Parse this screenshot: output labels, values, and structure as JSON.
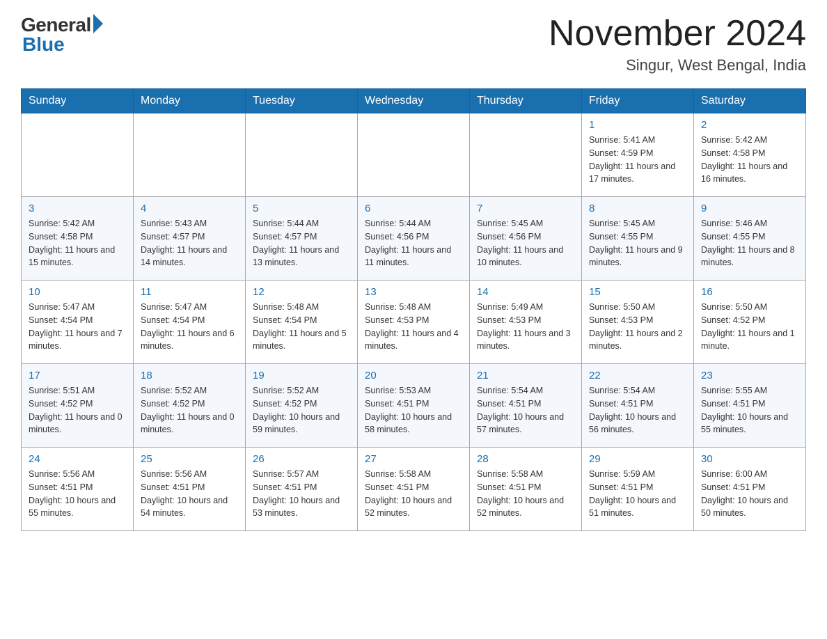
{
  "logo": {
    "general": "General",
    "blue": "Blue"
  },
  "title": {
    "month_year": "November 2024",
    "location": "Singur, West Bengal, India"
  },
  "headers": [
    "Sunday",
    "Monday",
    "Tuesday",
    "Wednesday",
    "Thursday",
    "Friday",
    "Saturday"
  ],
  "weeks": [
    [
      {
        "day": "",
        "info": ""
      },
      {
        "day": "",
        "info": ""
      },
      {
        "day": "",
        "info": ""
      },
      {
        "day": "",
        "info": ""
      },
      {
        "day": "",
        "info": ""
      },
      {
        "day": "1",
        "info": "Sunrise: 5:41 AM\nSunset: 4:59 PM\nDaylight: 11 hours and 17 minutes."
      },
      {
        "day": "2",
        "info": "Sunrise: 5:42 AM\nSunset: 4:58 PM\nDaylight: 11 hours and 16 minutes."
      }
    ],
    [
      {
        "day": "3",
        "info": "Sunrise: 5:42 AM\nSunset: 4:58 PM\nDaylight: 11 hours and 15 minutes."
      },
      {
        "day": "4",
        "info": "Sunrise: 5:43 AM\nSunset: 4:57 PM\nDaylight: 11 hours and 14 minutes."
      },
      {
        "day": "5",
        "info": "Sunrise: 5:44 AM\nSunset: 4:57 PM\nDaylight: 11 hours and 13 minutes."
      },
      {
        "day": "6",
        "info": "Sunrise: 5:44 AM\nSunset: 4:56 PM\nDaylight: 11 hours and 11 minutes."
      },
      {
        "day": "7",
        "info": "Sunrise: 5:45 AM\nSunset: 4:56 PM\nDaylight: 11 hours and 10 minutes."
      },
      {
        "day": "8",
        "info": "Sunrise: 5:45 AM\nSunset: 4:55 PM\nDaylight: 11 hours and 9 minutes."
      },
      {
        "day": "9",
        "info": "Sunrise: 5:46 AM\nSunset: 4:55 PM\nDaylight: 11 hours and 8 minutes."
      }
    ],
    [
      {
        "day": "10",
        "info": "Sunrise: 5:47 AM\nSunset: 4:54 PM\nDaylight: 11 hours and 7 minutes."
      },
      {
        "day": "11",
        "info": "Sunrise: 5:47 AM\nSunset: 4:54 PM\nDaylight: 11 hours and 6 minutes."
      },
      {
        "day": "12",
        "info": "Sunrise: 5:48 AM\nSunset: 4:54 PM\nDaylight: 11 hours and 5 minutes."
      },
      {
        "day": "13",
        "info": "Sunrise: 5:48 AM\nSunset: 4:53 PM\nDaylight: 11 hours and 4 minutes."
      },
      {
        "day": "14",
        "info": "Sunrise: 5:49 AM\nSunset: 4:53 PM\nDaylight: 11 hours and 3 minutes."
      },
      {
        "day": "15",
        "info": "Sunrise: 5:50 AM\nSunset: 4:53 PM\nDaylight: 11 hours and 2 minutes."
      },
      {
        "day": "16",
        "info": "Sunrise: 5:50 AM\nSunset: 4:52 PM\nDaylight: 11 hours and 1 minute."
      }
    ],
    [
      {
        "day": "17",
        "info": "Sunrise: 5:51 AM\nSunset: 4:52 PM\nDaylight: 11 hours and 0 minutes."
      },
      {
        "day": "18",
        "info": "Sunrise: 5:52 AM\nSunset: 4:52 PM\nDaylight: 11 hours and 0 minutes."
      },
      {
        "day": "19",
        "info": "Sunrise: 5:52 AM\nSunset: 4:52 PM\nDaylight: 10 hours and 59 minutes."
      },
      {
        "day": "20",
        "info": "Sunrise: 5:53 AM\nSunset: 4:51 PM\nDaylight: 10 hours and 58 minutes."
      },
      {
        "day": "21",
        "info": "Sunrise: 5:54 AM\nSunset: 4:51 PM\nDaylight: 10 hours and 57 minutes."
      },
      {
        "day": "22",
        "info": "Sunrise: 5:54 AM\nSunset: 4:51 PM\nDaylight: 10 hours and 56 minutes."
      },
      {
        "day": "23",
        "info": "Sunrise: 5:55 AM\nSunset: 4:51 PM\nDaylight: 10 hours and 55 minutes."
      }
    ],
    [
      {
        "day": "24",
        "info": "Sunrise: 5:56 AM\nSunset: 4:51 PM\nDaylight: 10 hours and 55 minutes."
      },
      {
        "day": "25",
        "info": "Sunrise: 5:56 AM\nSunset: 4:51 PM\nDaylight: 10 hours and 54 minutes."
      },
      {
        "day": "26",
        "info": "Sunrise: 5:57 AM\nSunset: 4:51 PM\nDaylight: 10 hours and 53 minutes."
      },
      {
        "day": "27",
        "info": "Sunrise: 5:58 AM\nSunset: 4:51 PM\nDaylight: 10 hours and 52 minutes."
      },
      {
        "day": "28",
        "info": "Sunrise: 5:58 AM\nSunset: 4:51 PM\nDaylight: 10 hours and 52 minutes."
      },
      {
        "day": "29",
        "info": "Sunrise: 5:59 AM\nSunset: 4:51 PM\nDaylight: 10 hours and 51 minutes."
      },
      {
        "day": "30",
        "info": "Sunrise: 6:00 AM\nSunset: 4:51 PM\nDaylight: 10 hours and 50 minutes."
      }
    ]
  ]
}
